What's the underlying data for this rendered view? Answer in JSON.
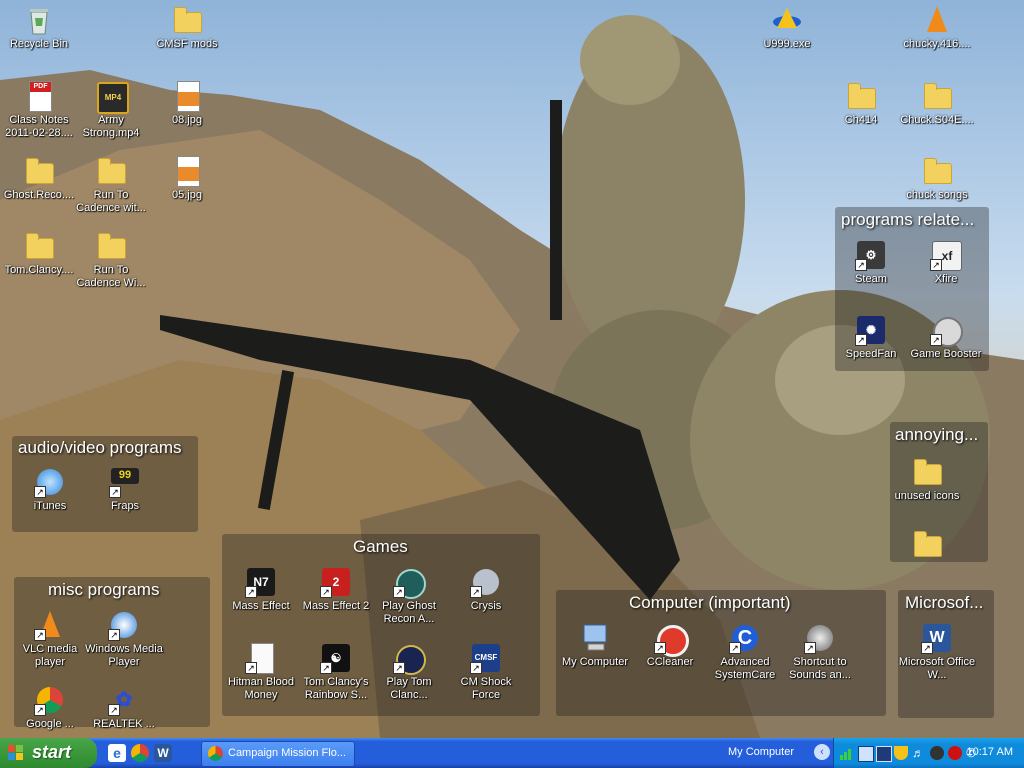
{
  "desktop": {
    "loose_icons": [
      {
        "id": "recycle-bin",
        "label": "Recycle Bin",
        "icon": "recycle-bin-icon"
      },
      {
        "id": "cmsf-mods",
        "label": "CMSF mods",
        "icon": "folder-icon"
      },
      {
        "id": "u999",
        "label": "U999.exe",
        "icon": "application-icon"
      },
      {
        "id": "chucky",
        "label": "chucky.416....",
        "icon": "vlc-cone-icon"
      },
      {
        "id": "class-notes",
        "label": "Class Notes 2011-02-28....",
        "icon": "pdf-icon"
      },
      {
        "id": "army-strong",
        "label": "Army Strong.mp4",
        "icon": "mp4-icon"
      },
      {
        "id": "img08",
        "label": "08.jpg",
        "icon": "image-file-icon"
      },
      {
        "id": "ch414",
        "label": "Ch414",
        "icon": "folder-icon"
      },
      {
        "id": "chuck-s04",
        "label": "Chuck.S04E....",
        "icon": "folder-icon"
      },
      {
        "id": "ghost-recon",
        "label": "Ghost.Reco....",
        "icon": "folder-icon"
      },
      {
        "id": "run-cadence-1",
        "label": "Run To Cadence wit...",
        "icon": "folder-icon"
      },
      {
        "id": "img05",
        "label": "05.jpg",
        "icon": "image-file-icon"
      },
      {
        "id": "chuck-songs",
        "label": "chuck songs",
        "icon": "folder-icon"
      },
      {
        "id": "tom-clancy",
        "label": "Tom.Clancy....",
        "icon": "folder-icon"
      },
      {
        "id": "run-cadence-2",
        "label": "Run To Cadence Wi...",
        "icon": "folder-icon"
      }
    ],
    "fences": {
      "programs_related": {
        "title": "programs  relate...",
        "items": [
          {
            "label": "Steam",
            "icon": "steam-icon"
          },
          {
            "label": "Xfire",
            "icon": "xfire-icon"
          },
          {
            "label": "SpeedFan",
            "icon": "speedfan-icon"
          },
          {
            "label": "Game Booster",
            "icon": "game-booster-icon"
          }
        ]
      },
      "audio_video": {
        "title": "audio/video programs",
        "items": [
          {
            "label": "iTunes",
            "icon": "itunes-icon"
          },
          {
            "label": "Fraps",
            "icon": "fraps-icon"
          }
        ]
      },
      "annoying": {
        "title": "annoying...",
        "items": [
          {
            "label": "unused icons",
            "icon": "folder-icon"
          }
        ]
      },
      "games": {
        "title": "Games",
        "items": [
          {
            "label": "Mass Effect",
            "icon": "mass-effect-icon"
          },
          {
            "label": "Mass Effect 2",
            "icon": "mass-effect-2-icon"
          },
          {
            "label": "Play Ghost Recon A...",
            "icon": "ghost-recon-icon"
          },
          {
            "label": "Crysis",
            "icon": "crysis-icon"
          },
          {
            "label": "Hitman Blood Money",
            "icon": "hitman-icon"
          },
          {
            "label": "Tom Clancy's Rainbow S...",
            "icon": "rainbow-six-icon"
          },
          {
            "label": "Play Tom Clanc...",
            "icon": "tom-clancy-game-icon"
          },
          {
            "label": "CM Shock Force",
            "icon": "cmsf-icon"
          }
        ]
      },
      "misc": {
        "title": "misc programs",
        "items": [
          {
            "label": "VLC media player",
            "icon": "vlc-cone-icon"
          },
          {
            "label": "Windows Media Player",
            "icon": "windows-media-player-icon"
          },
          {
            "label": "Google ...",
            "icon": "chrome-icon"
          },
          {
            "label": "REALTEK ...",
            "icon": "realtek-icon"
          }
        ]
      },
      "computer": {
        "title": "Computer (important)",
        "items": [
          {
            "label": "My Computer",
            "icon": "my-computer-icon"
          },
          {
            "label": "CCleaner",
            "icon": "ccleaner-icon"
          },
          {
            "label": "Advanced SystemCare",
            "icon": "advanced-systemcare-icon"
          },
          {
            "label": "Shortcut to Sounds an...",
            "icon": "speaker-icon"
          }
        ]
      },
      "microsoft": {
        "title": "Microsof...",
        "items": [
          {
            "label": "Microsoft Office W...",
            "icon": "word-icon"
          }
        ]
      }
    }
  },
  "taskbar": {
    "start_label": "start",
    "quick_launch": [
      "internet-explorer-icon",
      "chrome-icon",
      "word-icon"
    ],
    "tasks": [
      {
        "label": "Campaign Mission Flo...",
        "icon": "chrome-icon"
      }
    ],
    "toolbar_label": "My Computer",
    "tray_icons": [
      "network-signal-icon",
      "network-icon",
      "monitor-icon",
      "shield-icon",
      "volume-icon",
      "steam-icon",
      "antivirus-icon",
      "printer-icon",
      "display-icon"
    ],
    "clock": "10:17 AM"
  },
  "colors": {
    "taskbar": "#245edb",
    "start": "#3c9a3c",
    "tray": "#0f8bdb",
    "folder": "#f2d15f"
  }
}
